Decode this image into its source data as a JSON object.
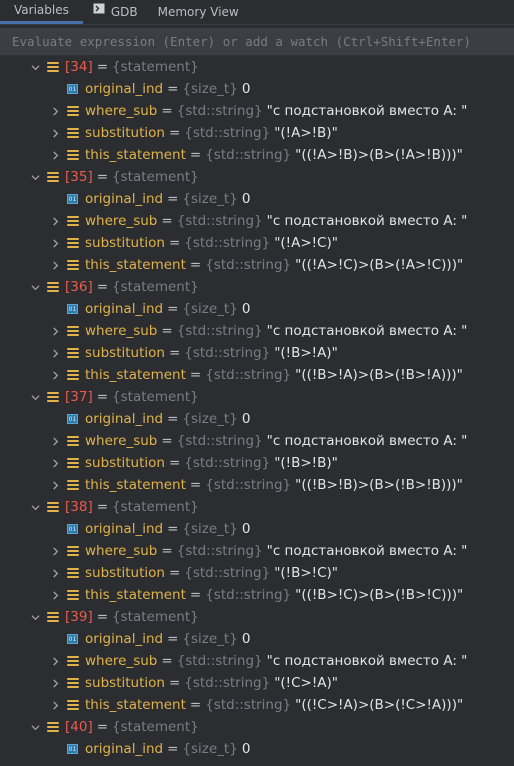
{
  "tabs": [
    {
      "label": "Variables",
      "icon": "",
      "active": true
    },
    {
      "label": "GDB",
      "icon": "gdb-console-icon",
      "active": false
    },
    {
      "label": "Memory View",
      "icon": "",
      "active": false
    }
  ],
  "eval": {
    "placeholder": "Evaluate expression (Enter) or add a watch (Ctrl+Shift+Enter)"
  },
  "equals": "=",
  "groups": [
    {
      "index": "[34]",
      "type": "{statement}",
      "original_ind": {
        "name": "original_ind",
        "type": "{size_t}",
        "value": "0"
      },
      "where_sub": {
        "name": "where_sub",
        "type": "{std::string}",
        "value": "\"с подстановкой вместо A: \""
      },
      "substitution": {
        "name": "substitution",
        "type": "{std::string}",
        "value": "\"(!A>!B)\""
      },
      "this_statement": {
        "name": "this_statement",
        "type": "{std::string}",
        "value": "\"((!A>!B)>(B>(!A>!B)))\""
      }
    },
    {
      "index": "[35]",
      "type": "{statement}",
      "original_ind": {
        "name": "original_ind",
        "type": "{size_t}",
        "value": "0"
      },
      "where_sub": {
        "name": "where_sub",
        "type": "{std::string}",
        "value": "\"с подстановкой вместо A: \""
      },
      "substitution": {
        "name": "substitution",
        "type": "{std::string}",
        "value": "\"(!A>!C)\""
      },
      "this_statement": {
        "name": "this_statement",
        "type": "{std::string}",
        "value": "\"((!A>!C)>(B>(!A>!C)))\""
      }
    },
    {
      "index": "[36]",
      "type": "{statement}",
      "original_ind": {
        "name": "original_ind",
        "type": "{size_t}",
        "value": "0"
      },
      "where_sub": {
        "name": "where_sub",
        "type": "{std::string}",
        "value": "\"с подстановкой вместо A: \""
      },
      "substitution": {
        "name": "substitution",
        "type": "{std::string}",
        "value": "\"(!B>!A)\""
      },
      "this_statement": {
        "name": "this_statement",
        "type": "{std::string}",
        "value": "\"((!B>!A)>(B>(!B>!A)))\""
      }
    },
    {
      "index": "[37]",
      "type": "{statement}",
      "original_ind": {
        "name": "original_ind",
        "type": "{size_t}",
        "value": "0"
      },
      "where_sub": {
        "name": "where_sub",
        "type": "{std::string}",
        "value": "\"с подстановкой вместо A: \""
      },
      "substitution": {
        "name": "substitution",
        "type": "{std::string}",
        "value": "\"(!B>!B)\""
      },
      "this_statement": {
        "name": "this_statement",
        "type": "{std::string}",
        "value": "\"((!B>!B)>(B>(!B>!B)))\""
      }
    },
    {
      "index": "[38]",
      "type": "{statement}",
      "original_ind": {
        "name": "original_ind",
        "type": "{size_t}",
        "value": "0"
      },
      "where_sub": {
        "name": "where_sub",
        "type": "{std::string}",
        "value": "\"с подстановкой вместо A: \""
      },
      "substitution": {
        "name": "substitution",
        "type": "{std::string}",
        "value": "\"(!B>!C)\""
      },
      "this_statement": {
        "name": "this_statement",
        "type": "{std::string}",
        "value": "\"((!B>!C)>(B>(!B>!C)))\""
      }
    },
    {
      "index": "[39]",
      "type": "{statement}",
      "original_ind": {
        "name": "original_ind",
        "type": "{size_t}",
        "value": "0"
      },
      "where_sub": {
        "name": "where_sub",
        "type": "{std::string}",
        "value": "\"с подстановкой вместо A: \""
      },
      "substitution": {
        "name": "substitution",
        "type": "{std::string}",
        "value": "\"(!C>!A)\""
      },
      "this_statement": {
        "name": "this_statement",
        "type": "{std::string}",
        "value": "\"((!C>!A)>(B>(!C>!A)))\""
      }
    },
    {
      "index": "[40]",
      "type": "{statement}",
      "original_ind": {
        "name": "original_ind",
        "type": "{size_t}",
        "value": "0"
      }
    }
  ]
}
